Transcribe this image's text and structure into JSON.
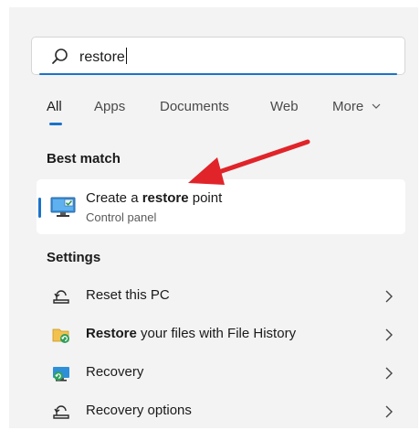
{
  "search": {
    "query": "restore"
  },
  "tabs": [
    {
      "label": "All",
      "active": true
    },
    {
      "label": "Apps",
      "active": false
    },
    {
      "label": "Documents",
      "active": false
    },
    {
      "label": "Web",
      "active": false
    },
    {
      "label": "More",
      "active": false
    }
  ],
  "best_match": {
    "heading": "Best match",
    "title_prefix": "Create a ",
    "title_bold": "restore",
    "title_suffix": " point",
    "subtitle": "Control panel",
    "icon": "system-restore-monitor-icon"
  },
  "settings": {
    "heading": "Settings",
    "items": [
      {
        "prefix": "",
        "bold": "",
        "text": "Reset this PC",
        "icon": "reset-pc-icon"
      },
      {
        "prefix": "",
        "bold": "Restore",
        "text": " your files with File History",
        "icon": "file-history-icon"
      },
      {
        "prefix": "",
        "bold": "",
        "text": "Recovery",
        "icon": "recovery-icon"
      },
      {
        "prefix": "",
        "bold": "",
        "text": "Recovery options",
        "icon": "recovery-options-icon"
      }
    ]
  },
  "colors": {
    "accent": "#1a73c8",
    "annotation_arrow": "#e0242a",
    "panel_bg": "#f3f3f3"
  }
}
